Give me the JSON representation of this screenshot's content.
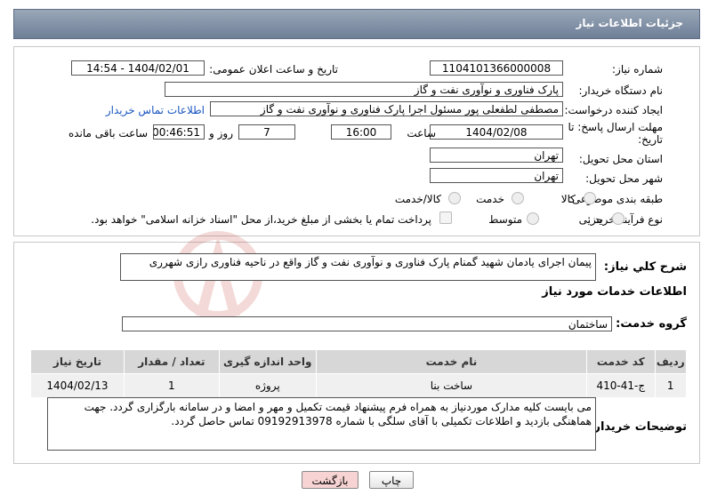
{
  "header": {
    "title": "جزئیات اطلاعات نیاز"
  },
  "info": {
    "need_number_label": "شماره نیاز:",
    "need_number": "1104101366000008",
    "announce_label": "تاریخ و ساعت اعلان عمومی:",
    "announce_value": "1404/02/01 - 14:54",
    "buyer_org_label": "نام دستگاه خریدار:",
    "buyer_org": "پارک فناوری و نوآوری نفت و گاز",
    "requester_label": "ایجاد کننده درخواست:",
    "requester": "مصطفی لطفعلی پور مسئول اجرا پارک فناوری و نوآوری نفت و گاز",
    "contact_link": "اطلاعات تماس خریدار",
    "deadline_label_1": "مهلت ارسال پاسخ: تا",
    "deadline_label_2": "تاریخ:",
    "deadline_date": "1404/02/08",
    "hour_label": "ساعت",
    "deadline_hour": "16:00",
    "days_value": "7",
    "days_label": "روز و",
    "remaining_value": "00:46:51",
    "remaining_label": "ساعت باقی مانده",
    "province_label": "استان محل تحویل:",
    "province": "تهران",
    "city_label": "شهر محل تحویل:",
    "city": "تهران",
    "category_label": "طبقه بندی موضوعی:",
    "category_options": [
      "کالا",
      "خدمت",
      "کالا/خدمت"
    ],
    "process_label": "نوع فرآیند خرید :",
    "process_options": [
      "جزیی",
      "متوسط"
    ],
    "payment_note": "پرداخت تمام یا بخشی از مبلغ خرید،از محل \"اسناد خزانه اسلامی\" خواهد بود."
  },
  "summary": {
    "label": "شرح کلي نياز:",
    "value": "پیمان اجرای یادمان شهید گمنام پارک فناوری و نوآوری نفت و گاز واقع در ناحیه فناوری رازی شهرری"
  },
  "services": {
    "section_title": "اطلاعات خدمات مورد نیاز",
    "group_label": "گروه خدمت:",
    "group_value": "ساختمان",
    "columns": [
      "ردیف",
      "کد خدمت",
      "نام خدمت",
      "واحد اندازه گیری",
      "تعداد / مقدار",
      "تاریخ نیاز"
    ],
    "rows": [
      [
        "1",
        "ج-41-410",
        "ساخت بنا",
        "پروژه",
        "1",
        "1404/02/13"
      ]
    ]
  },
  "notes": {
    "label": "توضیحات خریدار:",
    "value": "می بایست کلیه مدارک موردنیاز به همراه فرم پیشنهاد قیمت تکمیل و مهر و امضا و در سامانه بارگزاری گردد. جهت هماهنگی بازدید و اطلاعات تکمیلی با آقای سلگی با شماره 09192913978 تماس حاصل گردد."
  },
  "buttons": {
    "print": "چاپ",
    "back": "بازگشت"
  },
  "colors": {
    "header_bg": "#7f8fa6",
    "back_btn_bg": "#f7d3d3",
    "link": "#1a55c0"
  }
}
